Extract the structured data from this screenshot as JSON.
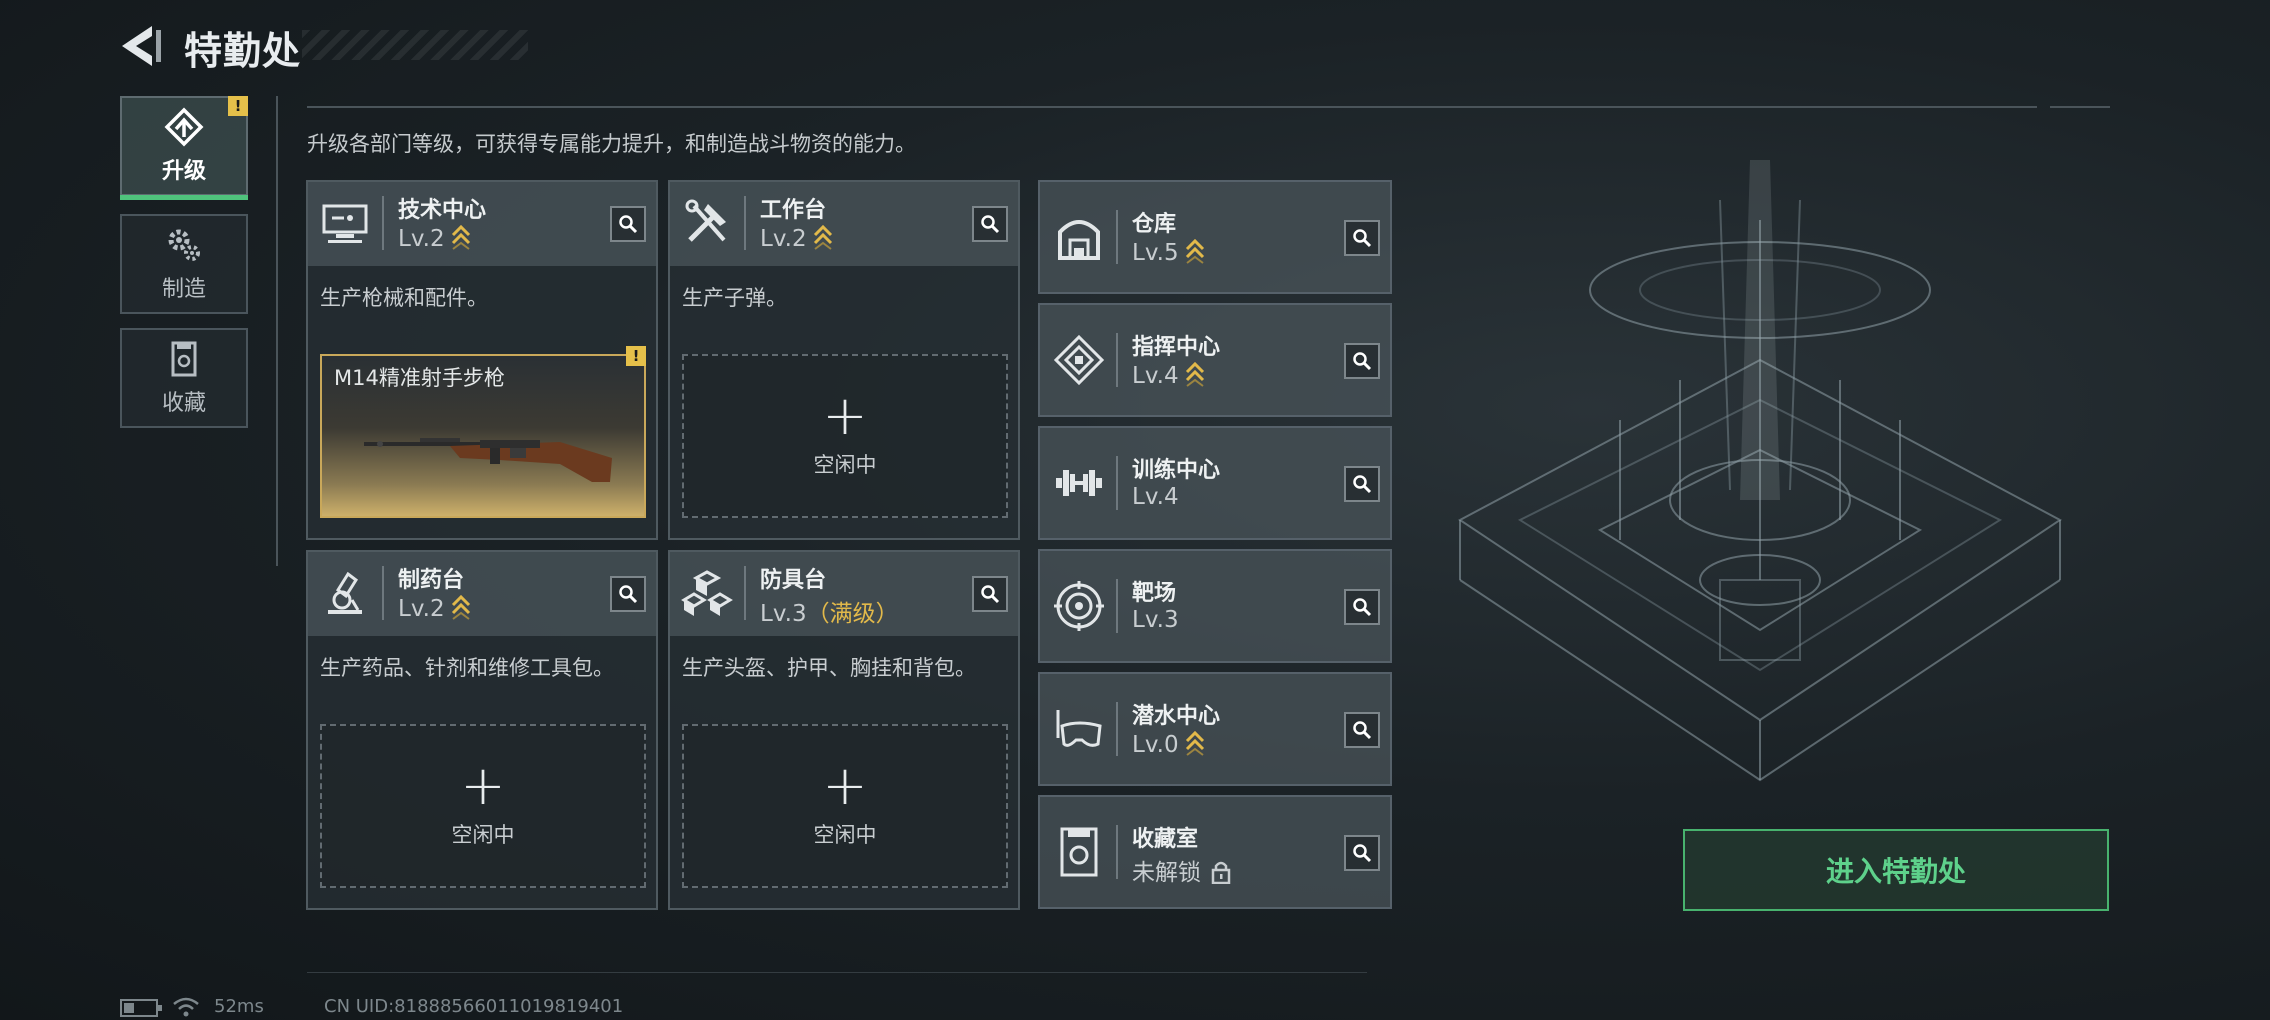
{
  "header": {
    "title": "特勤处"
  },
  "sidebar": {
    "tabs": [
      {
        "label": "升级",
        "icon": "upgrade-icon",
        "active": true,
        "alert": "!"
      },
      {
        "label": "制造",
        "icon": "gears-icon",
        "active": false
      },
      {
        "label": "收藏",
        "icon": "collection-icon",
        "active": false
      }
    ]
  },
  "description": "升级各部门等级，可获得专属能力提升，和制造战斗物资的能力。",
  "workshops": [
    {
      "name": "技术中心",
      "level": "Lv.2",
      "upgradable": true,
      "icon": "computer-icon",
      "text": "生产枪械和配件。",
      "slot": {
        "state": "item",
        "item_name": "M14精准射手步枪",
        "alert": "!"
      }
    },
    {
      "name": "工作台",
      "level": "Lv.2",
      "upgradable": true,
      "icon": "tools-icon",
      "text": "生产子弹。",
      "slot": {
        "state": "idle",
        "plus": "+",
        "label": "空闲中"
      }
    },
    {
      "name": "制药台",
      "level": "Lv.2",
      "upgradable": true,
      "icon": "microscope-icon",
      "text": "生产药品、针剂和维修工具包。",
      "slot": {
        "state": "idle",
        "plus": "+",
        "label": "空闲中"
      }
    },
    {
      "name": "防具台",
      "level": "Lv.3",
      "max_label": "（满级）",
      "upgradable": false,
      "icon": "cubes-icon",
      "text": "生产头盔、护甲、胸挂和背包。",
      "slot": {
        "state": "idle",
        "plus": "+",
        "label": "空闲中"
      }
    }
  ],
  "buildings": [
    {
      "name": "仓库",
      "level": "Lv.5",
      "upgradable": true,
      "icon": "warehouse-icon"
    },
    {
      "name": "指挥中心",
      "level": "Lv.4",
      "upgradable": true,
      "icon": "command-icon"
    },
    {
      "name": "训练中心",
      "level": "Lv.4",
      "upgradable": false,
      "icon": "dumbbell-icon"
    },
    {
      "name": "靶场",
      "level": "Lv.3",
      "upgradable": false,
      "icon": "target-icon"
    },
    {
      "name": "潜水中心",
      "level": "Lv.0",
      "upgradable": true,
      "icon": "diving-mask-icon"
    },
    {
      "name": "收藏室",
      "level": "未解锁",
      "upgradable": false,
      "locked": true,
      "icon": "collection-room-icon"
    }
  ],
  "enter_button": "进入特勤处",
  "status_bar": {
    "ping": "52ms",
    "uid": "CN UID:81888566011019819401"
  },
  "colors": {
    "accent_green": "#4fc37c",
    "upgrade_gold": "#e2b94a",
    "alert_yellow": "#e5c04a"
  }
}
